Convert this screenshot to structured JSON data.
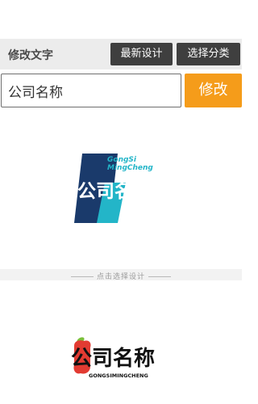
{
  "toolbar": {
    "title": "修改文字",
    "latest_label": "最新设计",
    "category_label": "选择分类"
  },
  "editor": {
    "input_value": "公司名称",
    "modify_label": "修改"
  },
  "logo_designs": [
    {
      "name_text": "公司名称",
      "pinyin_line1": "GongSi",
      "pinyin_line2": "MingCheng",
      "colors": {
        "dark": "#1a3a6b",
        "accent": "#23b5c8",
        "navy": "#0f2b57"
      }
    },
    {
      "name_text": "公司名称",
      "pinyin": "GONGSIMINGCHENG",
      "colors": {
        "red": "#e23b32",
        "black": "#111111",
        "leaf": "#7bbf3a"
      }
    }
  ],
  "divider": {
    "text": "点击选择设计"
  },
  "accent_colors": {
    "toolbar_button": "#3f3f3f",
    "modify_button": "#f59c1a"
  }
}
